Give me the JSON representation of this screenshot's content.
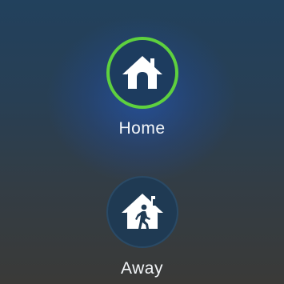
{
  "modes": [
    {
      "label": "Home",
      "icon": "house-icon",
      "selected": true
    },
    {
      "label": "Away",
      "icon": "house-person-walking-icon",
      "selected": false
    }
  ],
  "colors": {
    "selected_ring": "#5ed13e",
    "circle_fill": "#1d3c5f",
    "label_text": "#f3f6f9"
  }
}
